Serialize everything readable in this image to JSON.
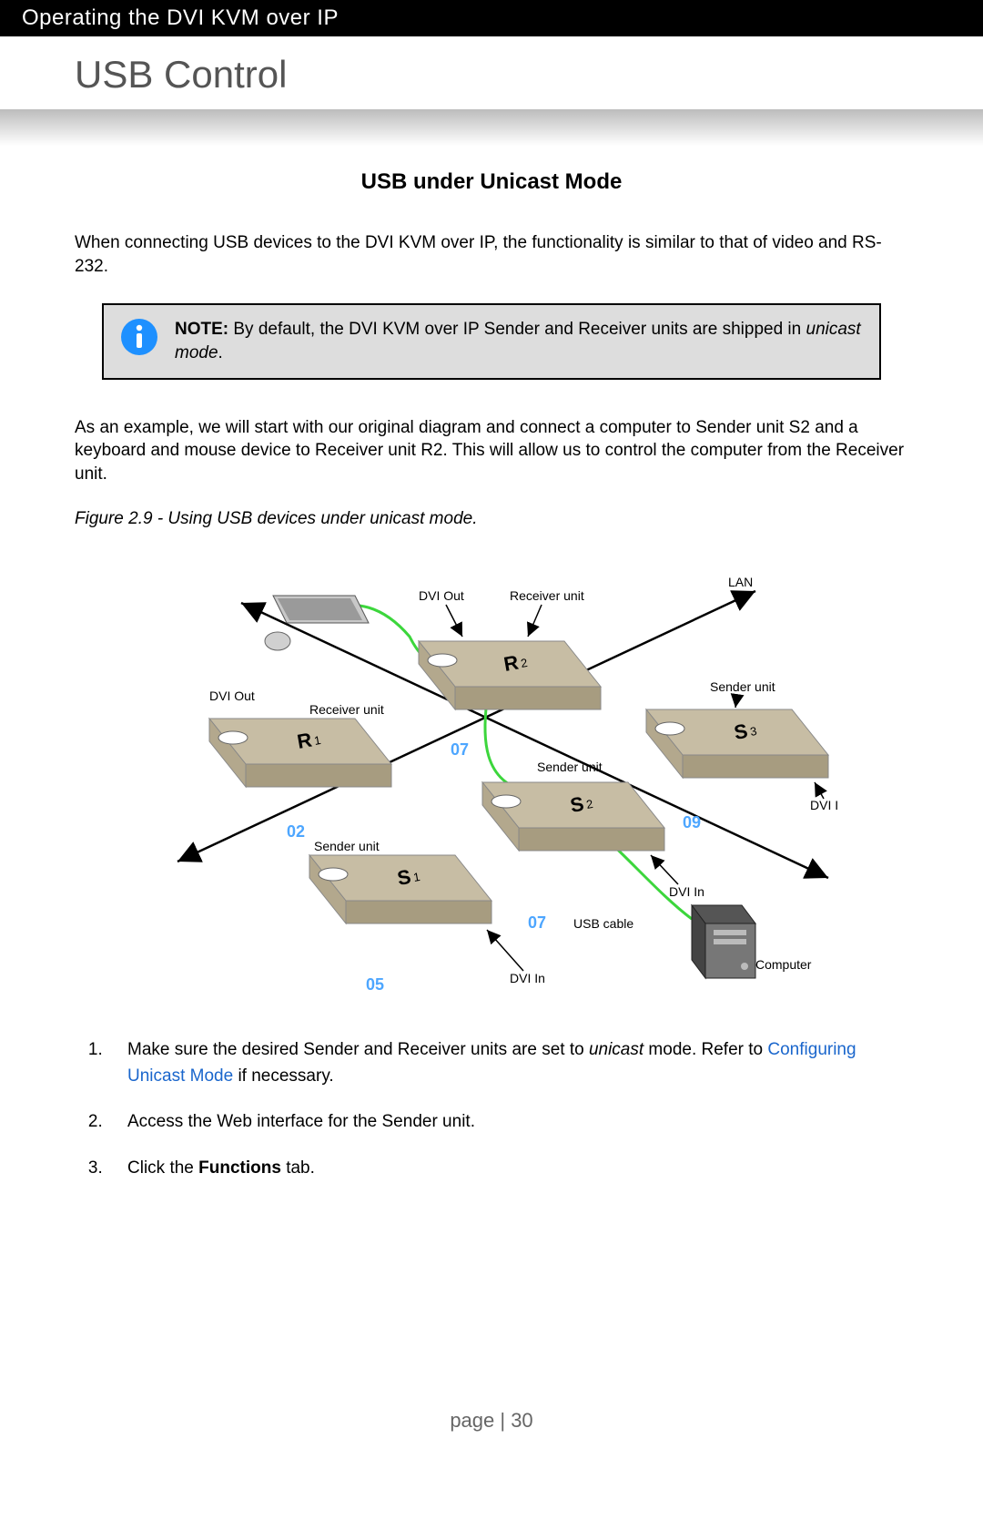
{
  "header": {
    "breadcrumb": "Operating the DVI KVM over IP",
    "title": "USB Control"
  },
  "section": {
    "subheading": "USB under Unicast Mode",
    "intro": "When connecting USB devices to the DVI KVM over IP, the functionality is similar to that of video and RS-232.",
    "note_label": "NOTE:",
    "note_body": "  By default, the DVI KVM over IP Sender and Receiver units are shipped in ",
    "note_italic": "unicast mode",
    "note_tail": ".",
    "example": "As an example, we will start with our original diagram and connect a computer to Sender unit S2 and a keyboard and mouse device to Receiver unit R2.  This will allow us to control the computer from the Receiver unit.",
    "figure_caption": "Figure 2.9 - Using USB devices under unicast mode."
  },
  "diagram": {
    "labels": {
      "receiver_unit": "Receiver unit",
      "sender_unit": "Sender unit",
      "dvi_out": "DVI Out",
      "dvi_in": "DVI In",
      "lan": "LAN",
      "usb_cable": "USB cable",
      "computer": "Computer"
    },
    "nodes": {
      "r1": "R₁",
      "r2": "R₂",
      "s1": "S₁",
      "s2": "S₂",
      "s3": "S₃"
    },
    "channels": {
      "r1": "02",
      "r2": "07",
      "s1": "05",
      "s2": "07",
      "s3": "09"
    }
  },
  "steps": {
    "s1_pre": "Make sure the desired Sender and Receiver units are set to ",
    "s1_italic": "unicast",
    "s1_mid": " mode.  Refer to ",
    "s1_link": "Configuring Unicast Mode",
    "s1_post": " if necessary.",
    "s2": "Access the Web interface for the Sender unit.",
    "s3_pre": "Click the ",
    "s3_bold": "Functions",
    "s3_post": " tab."
  },
  "footer": {
    "page_label": "page | 30"
  }
}
